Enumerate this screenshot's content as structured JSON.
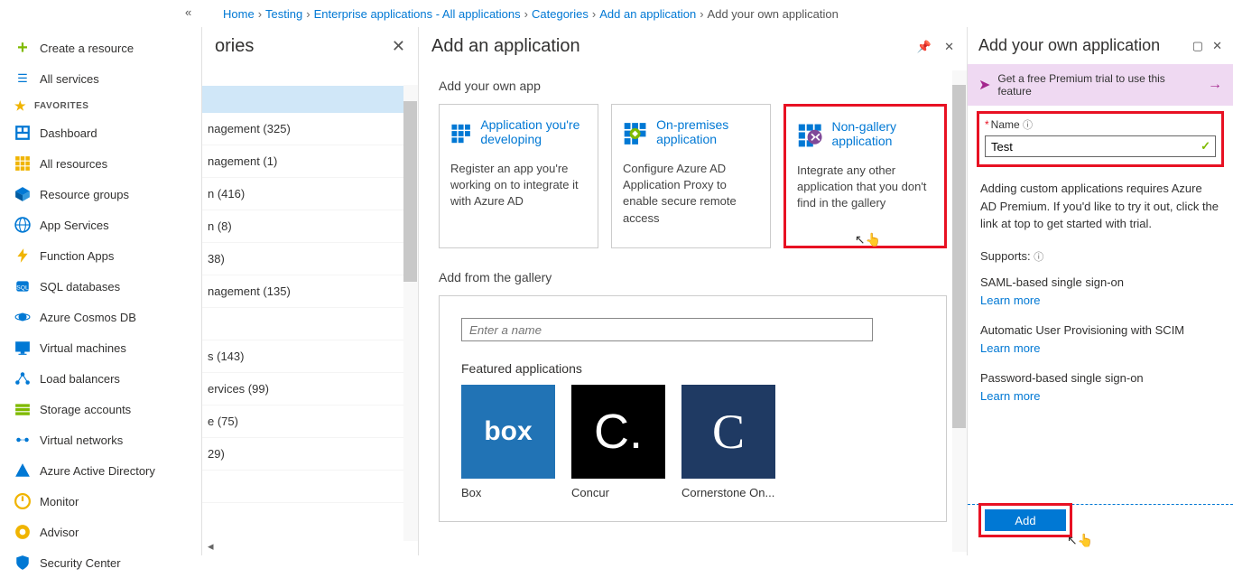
{
  "breadcrumb": {
    "home": "Home",
    "testing": "Testing",
    "ent": "Enterprise applications - All applications",
    "cat": "Categories",
    "add": "Add an application",
    "own": "Add your own application"
  },
  "sidebar": {
    "create": "Create a resource",
    "all_services": "All services",
    "favorites": "FAVORITES",
    "items": [
      {
        "label": "Dashboard"
      },
      {
        "label": "All resources"
      },
      {
        "label": "Resource groups"
      },
      {
        "label": "App Services"
      },
      {
        "label": "Function Apps"
      },
      {
        "label": "SQL databases"
      },
      {
        "label": "Azure Cosmos DB"
      },
      {
        "label": "Virtual machines"
      },
      {
        "label": "Load balancers"
      },
      {
        "label": "Storage accounts"
      },
      {
        "label": "Virtual networks"
      },
      {
        "label": "Azure Active Directory"
      },
      {
        "label": "Monitor"
      },
      {
        "label": "Advisor"
      },
      {
        "label": "Security Center"
      }
    ]
  },
  "categories": {
    "title": "ories",
    "rows": [
      "nagement (325)",
      "nagement (1)",
      "n (416)",
      "n (8)",
      "38)",
      "nagement (135)",
      "",
      "s (143)",
      "ervices (99)",
      "e (75)",
      "29)",
      ""
    ]
  },
  "app_panel": {
    "title": "Add an application",
    "own_app": "Add your own app",
    "cards": [
      {
        "title": "Application you're developing",
        "desc": "Register an app you're working on to integrate it with Azure AD"
      },
      {
        "title": "On-premises application",
        "desc": "Configure Azure AD Application Proxy to enable secure remote access"
      },
      {
        "title": "Non-gallery application",
        "desc": "Integrate any other application that you don't find in the gallery"
      }
    ],
    "from_gallery": "Add from the gallery",
    "search_placeholder": "Enter a name",
    "featured": "Featured applications",
    "tiles": [
      {
        "label": "Box"
      },
      {
        "label": "Concur"
      },
      {
        "label": "Cornerstone On..."
      }
    ]
  },
  "own_panel": {
    "title": "Add your own application",
    "promo": "Get a free Premium trial to use this feature",
    "name_label": "Name",
    "name_value": "Test",
    "desc": "Adding custom applications requires Azure AD Premium. If you'd like to try it out, click the link at top to get started with trial.",
    "supports": "Supports:",
    "items": [
      {
        "t": "SAML-based single sign-on",
        "l": "Learn more"
      },
      {
        "t": "Automatic User Provisioning with SCIM",
        "l": "Learn more"
      },
      {
        "t": "Password-based single sign-on",
        "l": "Learn more"
      }
    ],
    "add": "Add"
  }
}
